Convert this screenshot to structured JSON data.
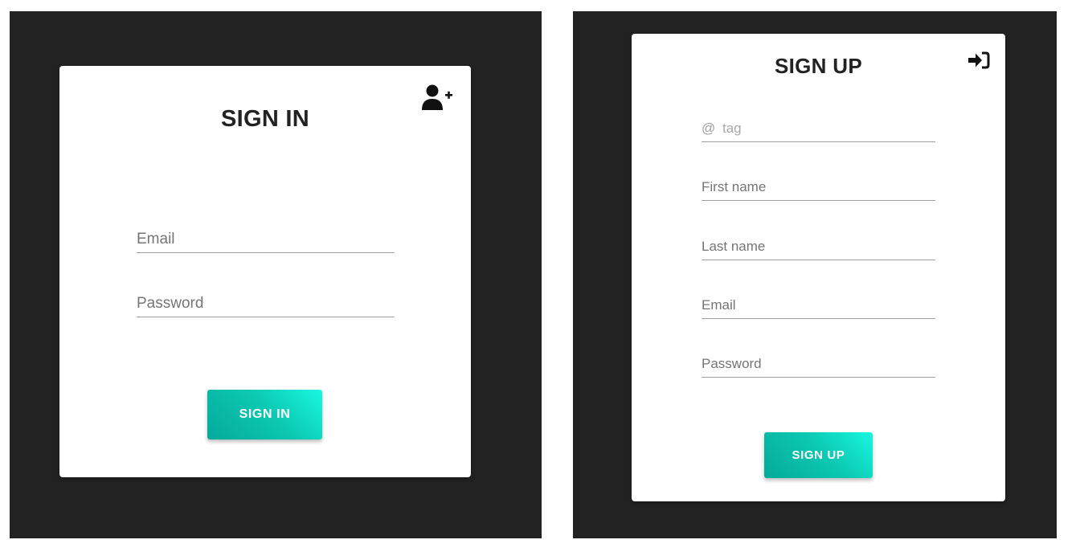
{
  "signin": {
    "title": "SIGN IN",
    "email_placeholder": "Email",
    "password_placeholder": "Password",
    "button_label": "SIGN IN",
    "corner_icon": "user-plus-icon"
  },
  "signup": {
    "title": "SIGN UP",
    "tag_prefix": "@",
    "tag_placeholder": "tag",
    "first_name_placeholder": "First name",
    "last_name_placeholder": "Last name",
    "email_placeholder": "Email",
    "password_placeholder": "Password",
    "button_label": "SIGN UP",
    "corner_icon": "sign-in-icon"
  },
  "colors": {
    "panel_background": "#222222",
    "card_background": "#ffffff",
    "button_gradient_start": "#05a99a",
    "button_gradient_end": "#1af7e0"
  }
}
